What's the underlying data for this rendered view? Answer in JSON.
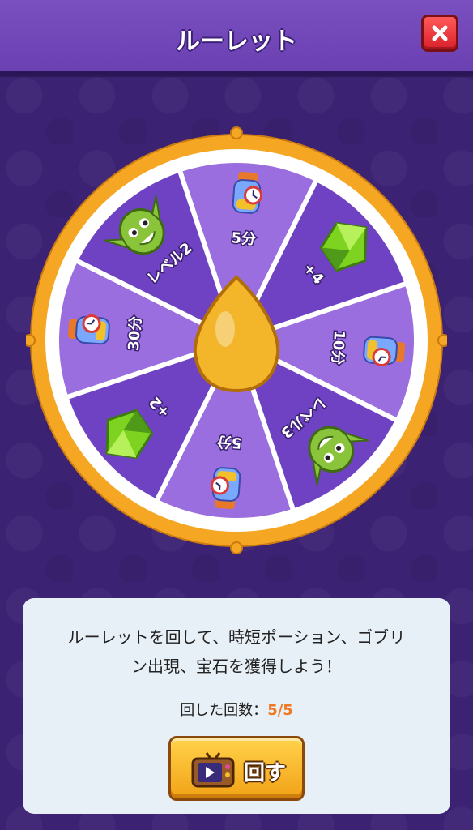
{
  "header": {
    "title": "ルーレット"
  },
  "wheel": {
    "segments": [
      {
        "label": "5分",
        "prize": "time-potion-icon"
      },
      {
        "label": "+4",
        "prize": "green-gem-icon"
      },
      {
        "label": "10分",
        "prize": "time-potion-icon"
      },
      {
        "label": "レベル3",
        "prize": "goblin-icon"
      },
      {
        "label": "5分",
        "prize": "time-potion-icon"
      },
      {
        "label": "+2",
        "prize": "green-gem-icon"
      },
      {
        "label": "30分",
        "prize": "time-potion-icon"
      },
      {
        "label": "レベル2",
        "prize": "goblin-icon"
      }
    ],
    "colors": {
      "light": "#9b6ee0",
      "dark": "#6f42c4",
      "rim": "#f5a623",
      "hub": "#f3b52a"
    }
  },
  "info": {
    "description_line1": "ルーレットを回して、時短ポーション、ゴブリ",
    "description_line2": "ン出現、宝石を獲得しよう！",
    "spin_count_label": "回した回数：",
    "spin_count_value": "5/5",
    "spin_button_label": "回す"
  }
}
